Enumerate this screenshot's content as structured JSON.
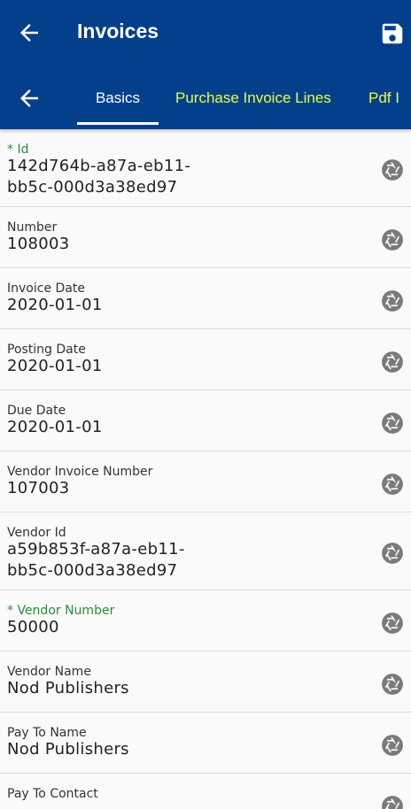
{
  "appbar": {
    "title": "Invoices",
    "back_icon": "arrow-left-icon",
    "save_icon": "save-icon"
  },
  "tabs": {
    "back_icon": "arrow-left-icon",
    "items": [
      {
        "label": "Basics",
        "active": true
      },
      {
        "label": "Purchase Invoice Lines",
        "active": false
      },
      {
        "label": "Pdf I",
        "active": false
      }
    ]
  },
  "fields": [
    {
      "label": "* Id",
      "required": true,
      "value": "142d764b-a87a-eb11-\nbb5c-000d3a38ed97"
    },
    {
      "label": "Number",
      "required": false,
      "value": "108003"
    },
    {
      "label": "Invoice Date",
      "required": false,
      "value": "2020-01-01"
    },
    {
      "label": "Posting Date",
      "required": false,
      "value": "2020-01-01"
    },
    {
      "label": "Due Date",
      "required": false,
      "value": "2020-01-01"
    },
    {
      "label": "Vendor Invoice Number",
      "required": false,
      "value": "107003"
    },
    {
      "label": "Vendor Id",
      "required": false,
      "value": "a59b853f-a87a-eb11-\nbb5c-000d3a38ed97"
    },
    {
      "label": "* Vendor Number",
      "required": true,
      "value": "50000"
    },
    {
      "label": "Vendor Name",
      "required": false,
      "value": "Nod Publishers"
    },
    {
      "label": "Pay To Name",
      "required": false,
      "value": "Nod Publishers"
    },
    {
      "label": "Pay To Contact",
      "required": false,
      "value": ""
    }
  ],
  "colors": {
    "header": "#043f8c",
    "active_tab_text": "#ffffff",
    "inactive_tab_text": "#e8ff3d",
    "required_label": "#2e8b3a"
  },
  "row_icon": "camera-shutter-icon"
}
